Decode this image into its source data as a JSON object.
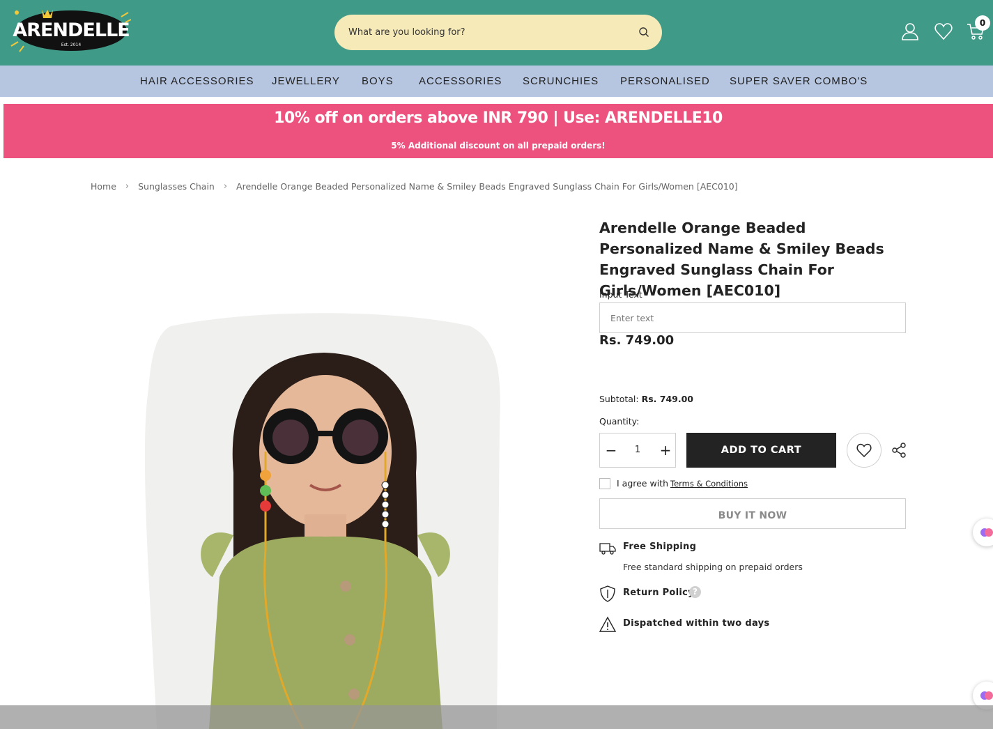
{
  "header": {
    "logo_text": "ARENDELLE",
    "logo_sub": "Est. 2014",
    "search_placeholder": "What are you looking for?",
    "cart_count": "0",
    "bg_color": "#3f9a88"
  },
  "nav": {
    "items": [
      {
        "label": "HAIR ACCESSORIES"
      },
      {
        "label": "JEWELLERY"
      },
      {
        "label": "BOYS"
      },
      {
        "label": "ACCESSORIES"
      },
      {
        "label": "SCRUNCHIES"
      },
      {
        "label": "PERSONALISED"
      },
      {
        "label": "SUPER SAVER COMBO'S"
      }
    ]
  },
  "promo": {
    "title": "10% off on orders above INR 790 | Use: ARENDELLE10",
    "subtitle": "5% Additional discount on all prepaid orders!",
    "bg_color": "#ec527d"
  },
  "breadcrumb": {
    "home": "Home",
    "category": "Sunglasses Chain",
    "current": "Arendelle Orange Beaded Personalized Name & Smiley Beads Engraved Sunglass Chain For Girls/Women [AEC010]"
  },
  "product": {
    "title": "Arendelle Orange Beaded Personalized Name & Smiley Beads Engraved Sunglass Chain For Girls/Women [AEC010]",
    "input_label": "Input Text",
    "input_placeholder": "Enter text",
    "price": "Rs. 749.00",
    "subtotal_label": "Subtotal:",
    "subtotal_value": "Rs. 749.00",
    "quantity_label": "Quantity:",
    "quantity": "1",
    "add_to_cart": "ADD TO CART",
    "agree_text": "I agree with",
    "terms_link": "Terms & Conditions",
    "buy_now": "BUY IT NOW"
  },
  "features": {
    "shipping_title": "Free Shipping",
    "shipping_sub": "Free standard shipping on prepaid orders",
    "return_title": "Return Policy",
    "dispatch_title": "Dispatched within two days"
  },
  "icons": {
    "search": "search-icon",
    "account": "user-icon",
    "wishlist": "heart-icon",
    "cart": "cart-icon",
    "share": "share-icon",
    "truck": "truck-icon",
    "shield": "shield-icon",
    "warning": "warning-icon",
    "help": "help-icon"
  }
}
